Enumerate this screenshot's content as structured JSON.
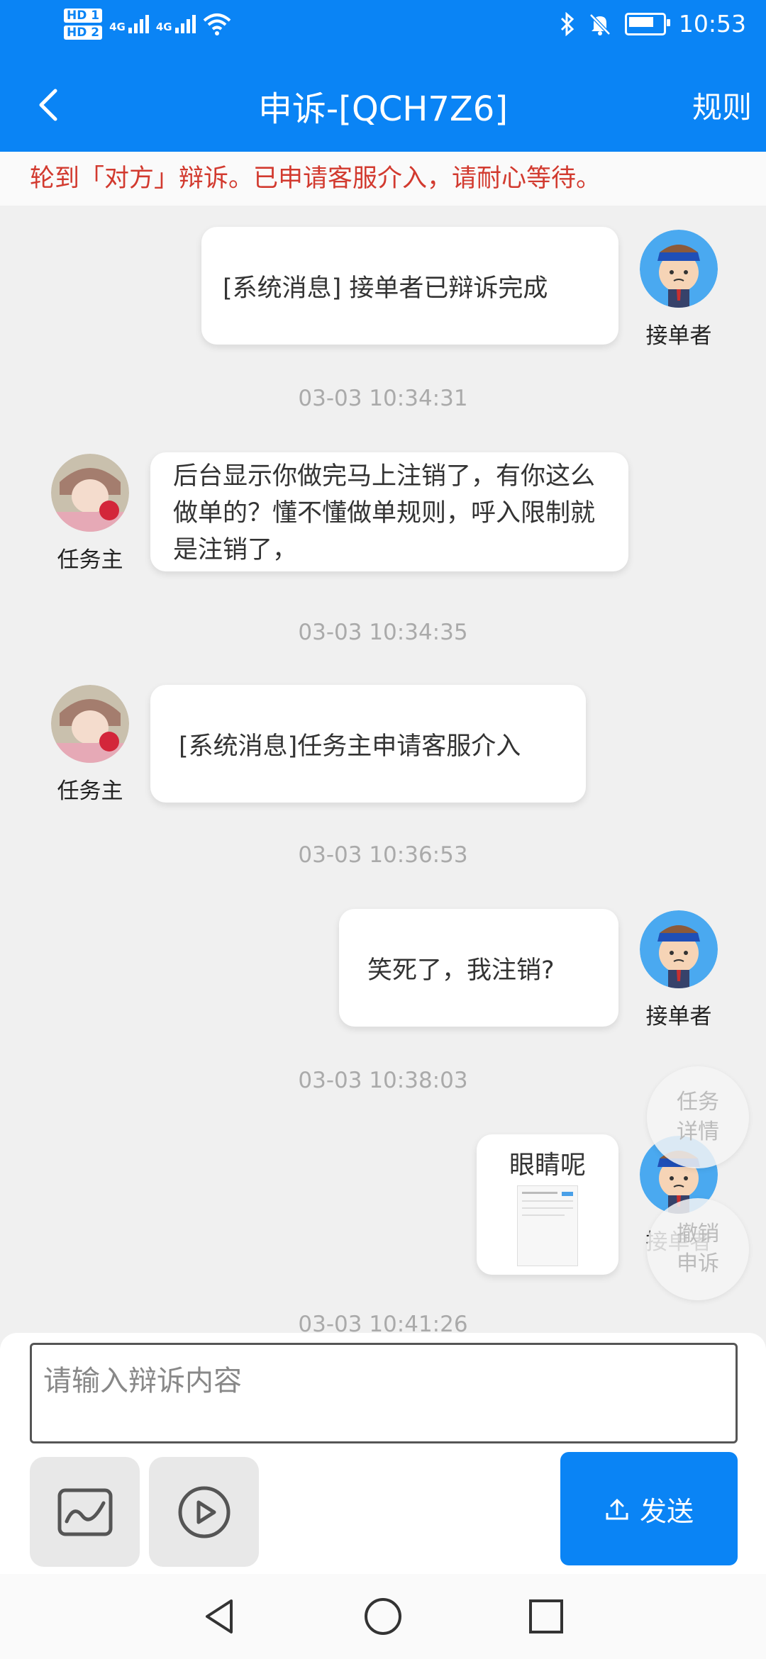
{
  "status_bar": {
    "sim1": "HD 1",
    "sim2": "HD 2",
    "net1": "4G",
    "net2": "4G",
    "time": "10:53"
  },
  "header": {
    "title": "申诉-[QCH7Z6]",
    "rules_label": "规则"
  },
  "notice": "轮到「对方」辩诉。已申请客服介入，请耐心等待。",
  "messages": [
    {
      "side": "right",
      "sender": "接单者",
      "text": "[系统消息] 接单者已辩诉完成"
    },
    {
      "timestamp": "03-03 10:34:31"
    },
    {
      "side": "left",
      "sender": "任务主",
      "text": "后台显示你做完马上注销了，有你这么做单的？懂不懂做单规则，呼入限制就是注销了，"
    },
    {
      "timestamp": "03-03 10:34:35"
    },
    {
      "side": "left",
      "sender": "任务主",
      "text": "[系统消息]任务主申请客服介入"
    },
    {
      "timestamp": "03-03 10:36:53"
    },
    {
      "side": "right",
      "sender": "接单者",
      "text": "笑死了，我注销?"
    },
    {
      "timestamp": "03-03 10:38:03"
    },
    {
      "side": "right",
      "sender": "接单者",
      "text": "眼睛呢"
    },
    {
      "timestamp": "03-03 10:41:26"
    }
  ],
  "floating": {
    "task_detail": "任务详情",
    "cancel_appeal": "撤销申诉"
  },
  "composer": {
    "placeholder": "请输入辩诉内容",
    "send_label": "发送"
  },
  "colors": {
    "primary": "#0a84f5",
    "notice_text": "#d23a2f"
  }
}
